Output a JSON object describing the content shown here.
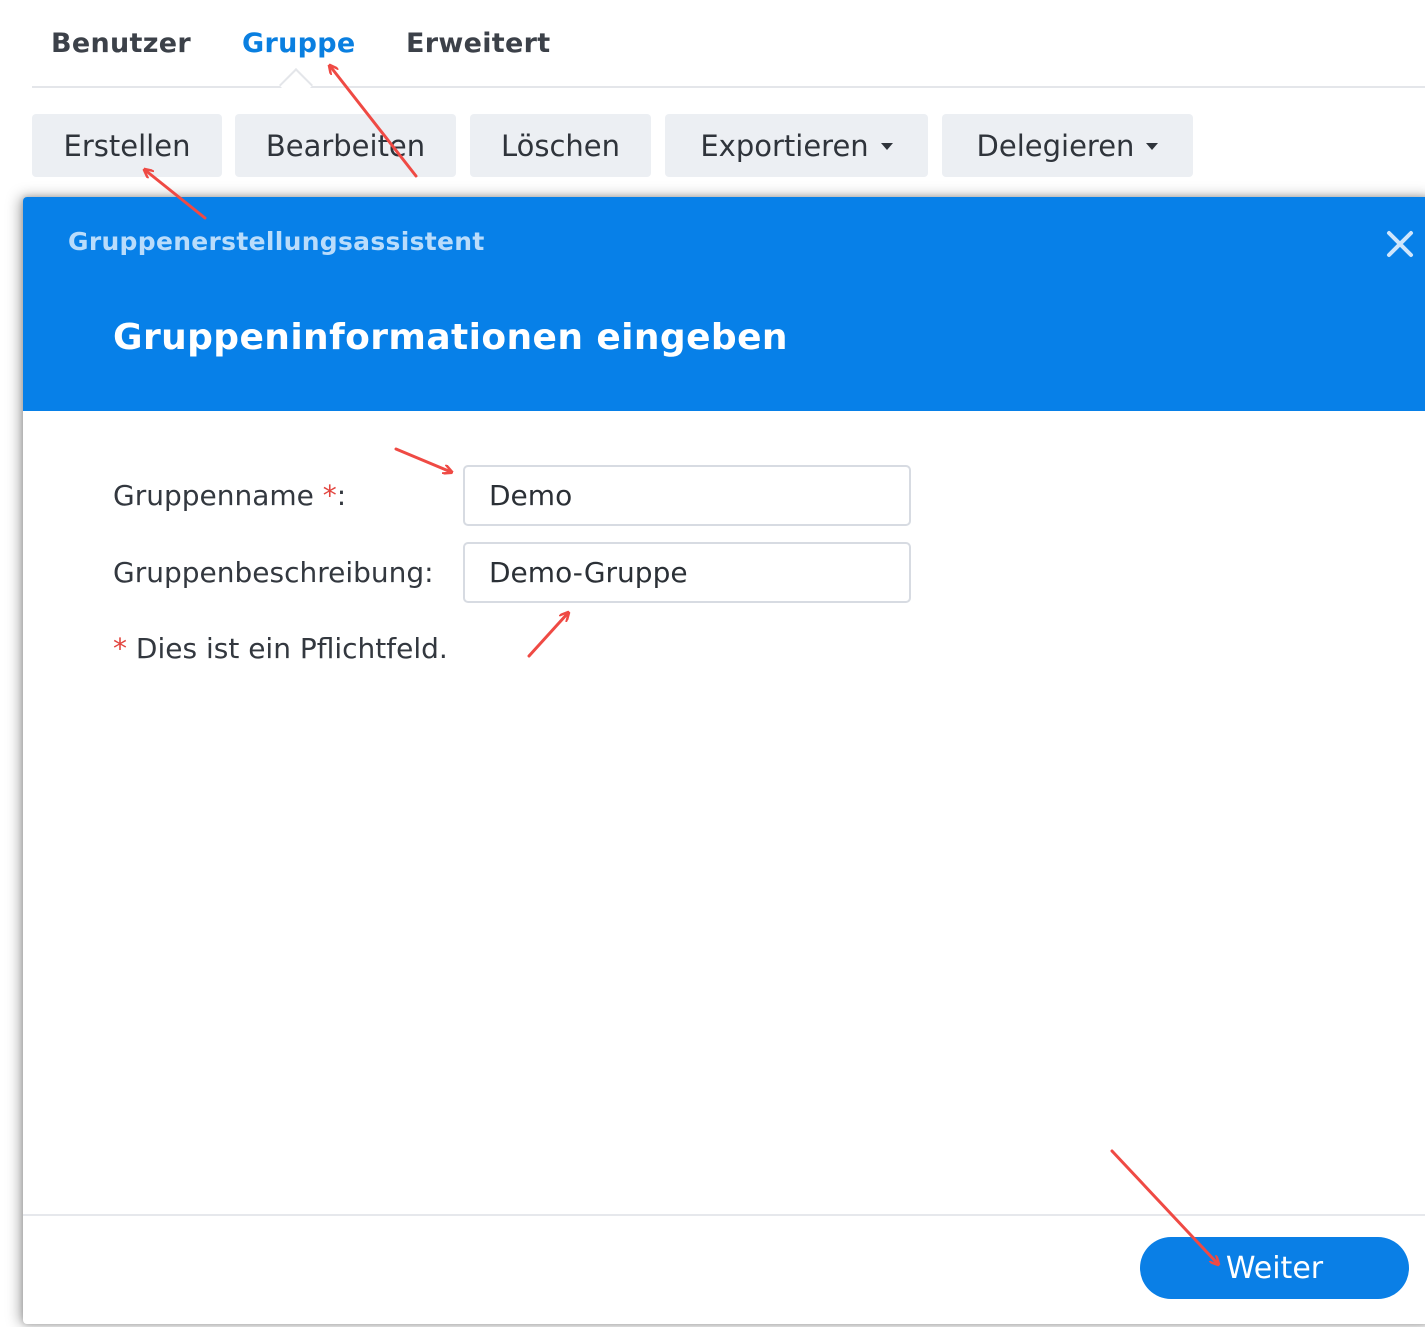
{
  "tabs": {
    "benutzer": "Benutzer",
    "gruppe": "Gruppe",
    "erweitert": "Erweitert",
    "active": "Gruppe"
  },
  "toolbar": {
    "erstellen": "Erstellen",
    "bearbeiten": "Bearbeiten",
    "loeschen": "Löschen",
    "exportieren": "Exportieren",
    "delegieren": "Delegieren"
  },
  "dialog": {
    "title": "Gruppenerstellungsassistent",
    "step_title": "Gruppeninformationen eingeben",
    "fields": {
      "name_label": "Gruppenname",
      "required_mark": "*",
      "label_suffix": ":",
      "name_value": "Demo",
      "desc_label": "Gruppenbeschreibung:",
      "desc_value": "Demo-Gruppe"
    },
    "note_mark": "*",
    "note_text": " Dies ist ein Pflichtfeld.",
    "next_button": "Weiter"
  },
  "icons": {
    "close": "close-icon",
    "dropdown": "caret-down-icon"
  },
  "colors": {
    "accent": "#0780e8",
    "active_tab": "#0a7fe0",
    "required": "#e2453f",
    "annotation_arrow": "#ef4a44"
  }
}
